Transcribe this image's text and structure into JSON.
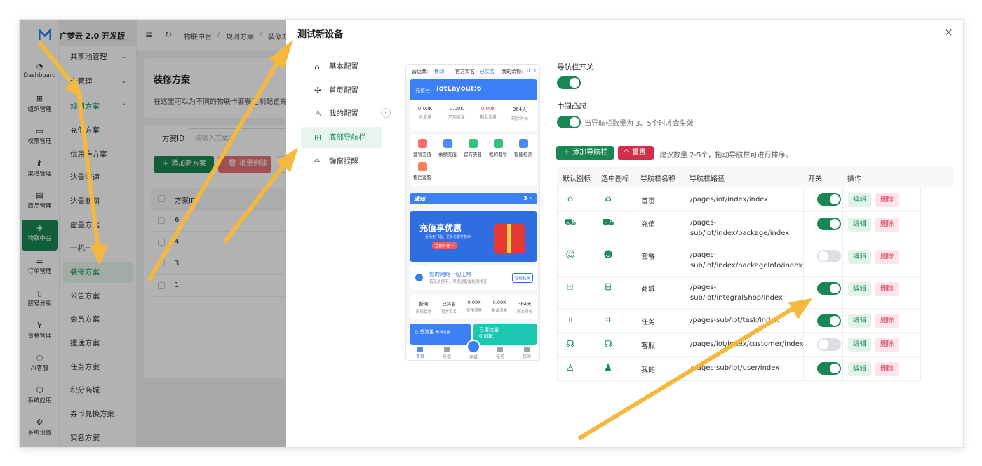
{
  "app": {
    "title": "广梦云 2.0 开发版"
  },
  "rail": [
    {
      "label": "Dashboard",
      "icon": "dashboard-icon"
    },
    {
      "label": "组织管理",
      "icon": "grid-icon"
    },
    {
      "label": "权限管理",
      "icon": "monitor-icon"
    },
    {
      "label": "渠道管理",
      "icon": "network-icon"
    },
    {
      "label": "商品管理",
      "icon": "store-icon"
    },
    {
      "label": "物联中台",
      "icon": "iot-icon"
    },
    {
      "label": "订单管理",
      "icon": "list-icon"
    },
    {
      "label": "靓号分销",
      "icon": "phone-icon"
    },
    {
      "label": "资金管理",
      "icon": "money-icon"
    },
    {
      "label": "AI客服",
      "icon": "ai-icon"
    },
    {
      "label": "系统应用",
      "icon": "cube-icon"
    },
    {
      "label": "系统设置",
      "icon": "settings-icon"
    }
  ],
  "submenu": [
    "共享池管理",
    "卡管理",
    "规则方案",
    "充值方案",
    "优惠券方案",
    "达量限速",
    "达量断网",
    "虚量方案",
    "一机一",
    "装修方案",
    "公告方案",
    "会员方案",
    "提速方案",
    "任务方案",
    "积分商城",
    "券币兑换方案",
    "实名方案"
  ],
  "topbar": {
    "crumb1": "物联中台",
    "crumb2": "规则方案",
    "crumb3": "装修方"
  },
  "page": {
    "title": "装修方案",
    "desc": "在这里可以为不同的物联卡套餐定制配置充",
    "filter_label": "方案ID",
    "filter_placeholder": "请输入方案ID",
    "add_btn": "添加新方案",
    "del_btn": "批量删除",
    "col": "方案ID",
    "ids": [
      "6",
      "4",
      "3",
      "1"
    ]
  },
  "drawer": {
    "title": "测试新设备",
    "close": "×",
    "nav": [
      {
        "label": "基本配置",
        "icon": "home-icon"
      },
      {
        "label": "首页配置",
        "icon": "puzzle-icon"
      },
      {
        "label": "我的配置",
        "icon": "user-icon"
      },
      {
        "label": "底部导航栏",
        "icon": "grid-icon"
      },
      {
        "label": "弹窗提醒",
        "icon": "alarm-icon"
      }
    ],
    "collapse": "‹"
  },
  "phone": {
    "operator_k": "营运商:",
    "operator_v": "移动",
    "realname_k": "官方实名:",
    "realname_v": "已实名",
    "balance_k": "我的余额:",
    "balance_v": "0.00",
    "card_k": "充值号:",
    "card_v": "IotLayout:6",
    "stats": [
      {
        "a": "0.00K",
        "b": "总流量"
      },
      {
        "a": "0.00K",
        "b": "已用流量"
      },
      {
        "a": "0.00K",
        "b": "剩余流量"
      },
      {
        "a": "364天",
        "b": "剩余时长"
      }
    ],
    "icons": [
      "套餐充值",
      "余额充值",
      "官方实名",
      "我的套餐",
      "智能检测",
      "售后客服"
    ],
    "notice": "通知",
    "notice_arrow": "3 ›",
    "banner_title": "充值享优惠",
    "banner_sub": "全场无门槛，更多优惠等着你",
    "banner_btn": "立即开抢 >",
    "net_title": "您的网络一切正常",
    "net_sub": "若无法使用，可通过智能检测排查",
    "net_btn": "智能检测",
    "sum": [
      {
        "a": "断网",
        "b": "网络状态"
      },
      {
        "a": "已实名",
        "b": "官方实名"
      },
      {
        "a": "0.00K",
        "b": "使用流量"
      },
      {
        "a": "0.00K",
        "b": "剩余流量"
      },
      {
        "a": "364天",
        "b": "剩余时长"
      }
    ],
    "flow1": "总流量",
    "flow1_sub": "刷新流量",
    "flow2": "已用流量",
    "flow2_val": "0.00K",
    "tabs": [
      "首页",
      "充值",
      "商城",
      "任务",
      "我的"
    ]
  },
  "config": {
    "nav_switch_label": "导航栏开关",
    "nav_switch_on": true,
    "center_label": "中间凸起",
    "center_on": true,
    "center_hint": "当导航栏数量为 3、5个时才会生效",
    "add_btn": "添加导航栏",
    "reset_btn": "重置",
    "suggest": "建议数量 2-5个，拖动导航栏可进行排序。",
    "columns": [
      "默认图标",
      "选中图标",
      "导航栏名称",
      "导航栏路径",
      "开关",
      "操作"
    ],
    "edit": "编辑",
    "delete": "删除",
    "rows": [
      {
        "name": "首页",
        "path": "/pages/iot/index/index",
        "on": true,
        "icon": "home-icon"
      },
      {
        "name": "充值",
        "path": "/pages-sub/iot/index/package/index",
        "on": true,
        "icon": "cart-icon"
      },
      {
        "name": "套餐",
        "path": "/pages-sub/iot/index/packageInfo/index",
        "on": false,
        "icon": "smile-icon"
      },
      {
        "name": "商城",
        "path": "/pages-sub/iot/integralShop/index",
        "on": true,
        "icon": "shop-icon"
      },
      {
        "name": "任务",
        "path": "/pages-sub/iot/task/index",
        "on": true,
        "icon": "tag-icon"
      },
      {
        "name": "客服",
        "path": "/pages/iot/index/customer/index",
        "on": false,
        "icon": "headset-icon"
      },
      {
        "name": "我的",
        "path": "/pages-sub/iot/user/index",
        "on": true,
        "icon": "user-icon"
      }
    ]
  },
  "colors": {
    "primary": "#198754",
    "danger": "#d32f4b",
    "annotation": "#f5b83d"
  }
}
